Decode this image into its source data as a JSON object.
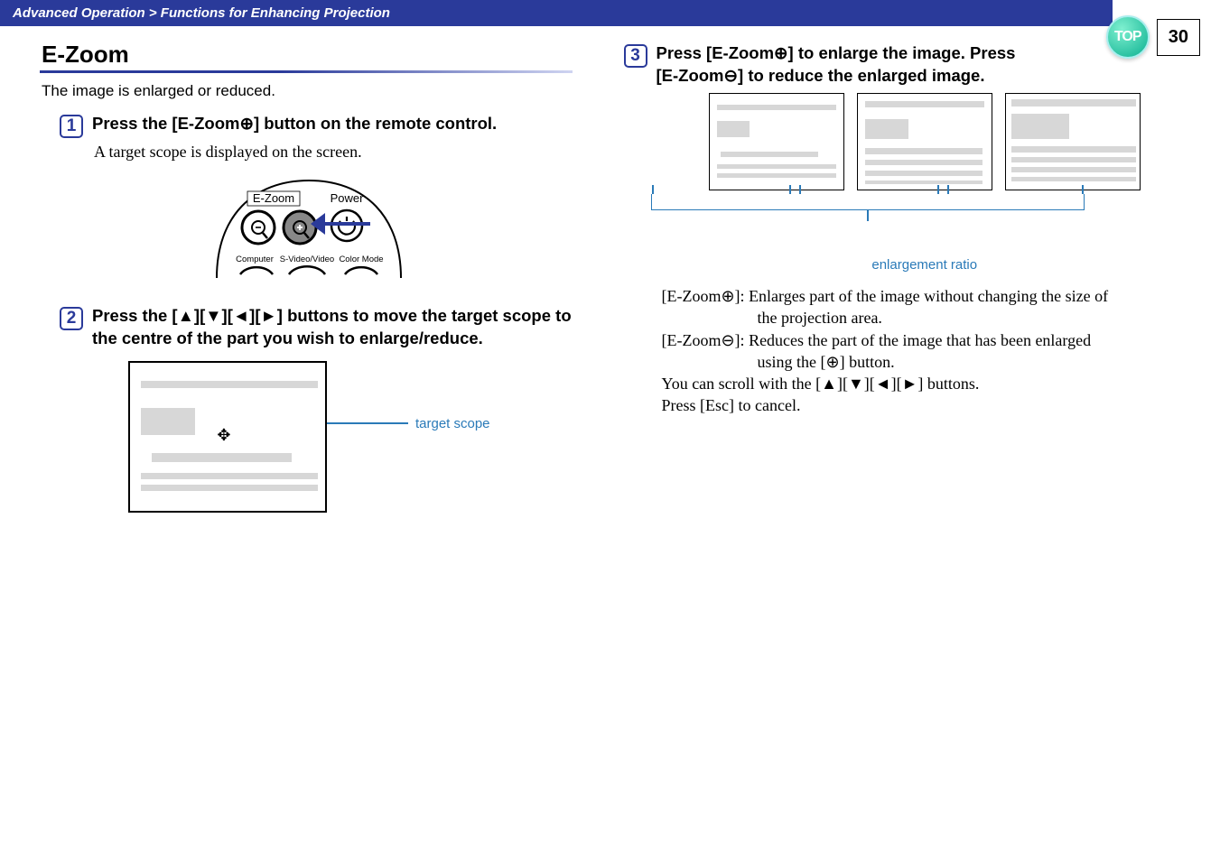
{
  "nav": {
    "top_label": "TOP",
    "page_number": "30"
  },
  "header": {
    "breadcrumb": "Advanced Operation > Functions for Enhancing Projection"
  },
  "section": {
    "title": "E-Zoom",
    "intro": "The image is enlarged or reduced."
  },
  "steps": {
    "s1": {
      "num": "1",
      "head": "Press the [E-Zoom⊕] button on the remote control.",
      "body": "A target scope is displayed on the screen."
    },
    "s2": {
      "num": "2",
      "head": "Press the [▲][▼][◄][►] buttons to move the target scope to the centre of the part you wish to enlarge/reduce."
    },
    "s3": {
      "num": "3",
      "head_l1": "Press [E-Zoom⊕] to enlarge the image. Press",
      "head_l2": "[E-Zoom⊖] to reduce the enlarged image."
    }
  },
  "remote": {
    "label_ezoom": "E-Zoom",
    "label_power": "Power",
    "label_computer": "Computer",
    "label_svideo": "S-Video/Video",
    "label_colormode": "Color Mode"
  },
  "callouts": {
    "target_scope": "target scope",
    "enlargement_ratio": "enlargement ratio"
  },
  "definitions": {
    "plus_label": "[E-Zoom⊕]: ",
    "plus_text_a": "Enlarges part of the image without changing the size of",
    "plus_text_b": "the projection area.",
    "minus_label": "[E-Zoom⊖]: ",
    "minus_text_a": "Reduces the part of the image that has been enlarged",
    "minus_text_b": "using the [⊕] button.",
    "scroll": "You can scroll with the [▲][▼][◄][►] buttons.",
    "esc": "Press [Esc] to cancel."
  }
}
